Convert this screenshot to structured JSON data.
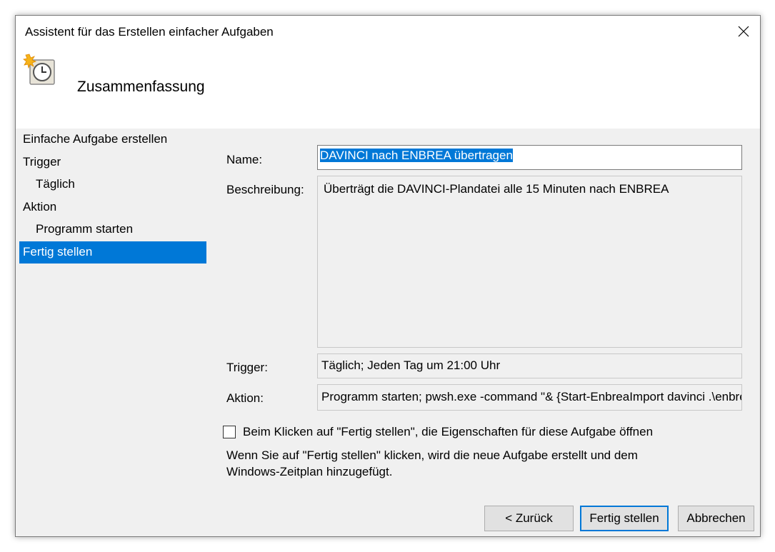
{
  "window": {
    "title": "Assistent für das Erstellen einfacher Aufgaben"
  },
  "header": {
    "title": "Zusammenfassung",
    "icon": "scheduled-task-clock-icon"
  },
  "sidebar": {
    "items": [
      {
        "label": "Einfache Aufgabe erstellen"
      },
      {
        "label": "Trigger"
      },
      {
        "label": "Täglich"
      },
      {
        "label": "Aktion"
      },
      {
        "label": "Programm starten"
      },
      {
        "label": "Fertig stellen"
      }
    ],
    "active_index": 5
  },
  "summary": {
    "name_label": "Name:",
    "name_value": "DAVINCI nach ENBREA übertragen",
    "description_label": "Beschreibung:",
    "description_value": "Überträgt die DAVINCI-Plandatei alle 15 Minuten nach ENBREA",
    "trigger_label": "Trigger:",
    "trigger_value": "Täglich; Jeden Tag um 21:00 Uhr",
    "action_label": "Aktion:",
    "action_value": "Programm starten; pwsh.exe -command \"& {Start-EnbreaImport davinci .\\enbrea.davinci.json -Skip"
  },
  "open_properties": {
    "label": "Beim Klicken auf \"Fertig stellen\", die Eigenschaften für diese Aufgabe öffnen",
    "checked": false
  },
  "info_text": {
    "line1": "Wenn Sie auf \"Fertig stellen\" klicken, wird die neue Aufgabe erstellt und dem",
    "line2": "Windows-Zeitplan hinzugefügt."
  },
  "buttons": {
    "back": "< Zurück",
    "finish": "Fertig stellen",
    "cancel": "Abbrechen"
  },
  "colors": {
    "accent": "#0078d7",
    "dialog_bg": "#f0f0f0"
  }
}
